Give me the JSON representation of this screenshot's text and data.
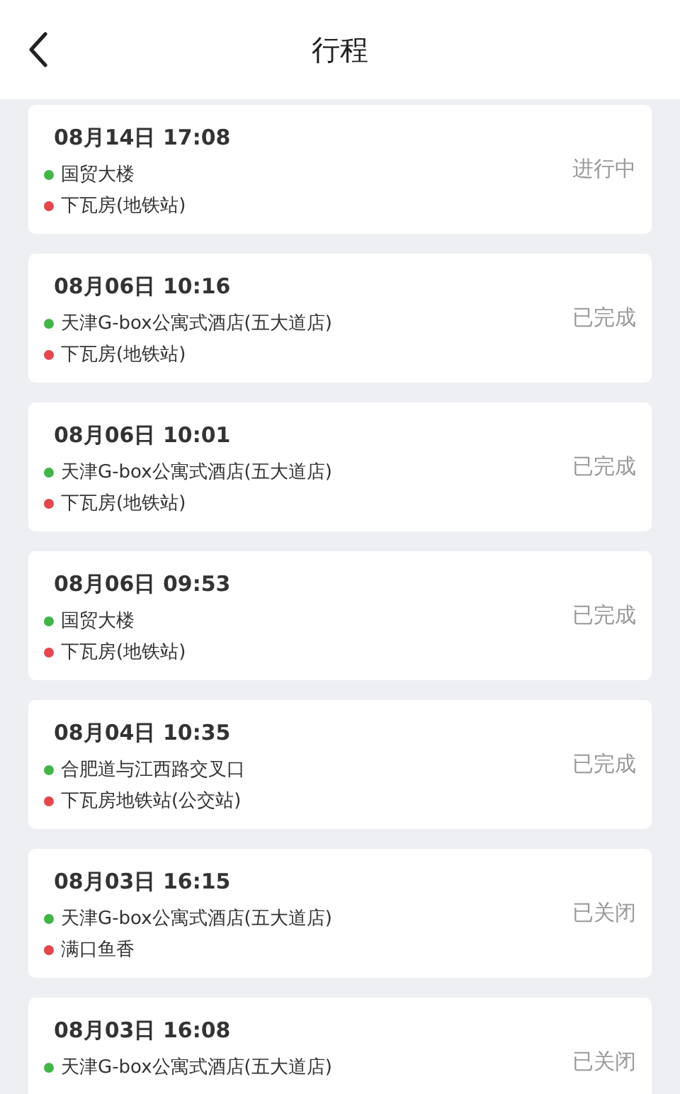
{
  "header": {
    "title": "行程"
  },
  "trips": [
    {
      "time": "08月14日 17:08",
      "status": "进行中",
      "stops": [
        {
          "kind": "start",
          "name": "国贸大楼"
        },
        {
          "kind": "end",
          "name": "下瓦房(地铁站)"
        }
      ]
    },
    {
      "time": "08月06日 10:16",
      "status": "已完成",
      "stops": [
        {
          "kind": "start",
          "name": "天津G-box公寓式酒店(五大道店)"
        },
        {
          "kind": "end",
          "name": "下瓦房(地铁站)"
        }
      ]
    },
    {
      "time": "08月06日 10:01",
      "status": "已完成",
      "stops": [
        {
          "kind": "start",
          "name": "天津G-box公寓式酒店(五大道店)"
        },
        {
          "kind": "end",
          "name": "下瓦房(地铁站)"
        }
      ]
    },
    {
      "time": "08月06日 09:53",
      "status": "已完成",
      "stops": [
        {
          "kind": "start",
          "name": "国贸大楼"
        },
        {
          "kind": "end",
          "name": "下瓦房(地铁站)"
        }
      ]
    },
    {
      "time": "08月04日 10:35",
      "status": "已完成",
      "stops": [
        {
          "kind": "start",
          "name": "合肥道与江西路交叉口"
        },
        {
          "kind": "end",
          "name": "下瓦房地铁站(公交站)"
        }
      ]
    },
    {
      "time": "08月03日 16:15",
      "status": "已关闭",
      "stops": [
        {
          "kind": "start",
          "name": "天津G-box公寓式酒店(五大道店)"
        },
        {
          "kind": "end",
          "name": "满口鱼香"
        }
      ]
    },
    {
      "time": "08月03日 16:08",
      "status": "已关闭",
      "stops": [
        {
          "kind": "start",
          "name": "天津G-box公寓式酒店(五大道店)"
        }
      ]
    }
  ]
}
